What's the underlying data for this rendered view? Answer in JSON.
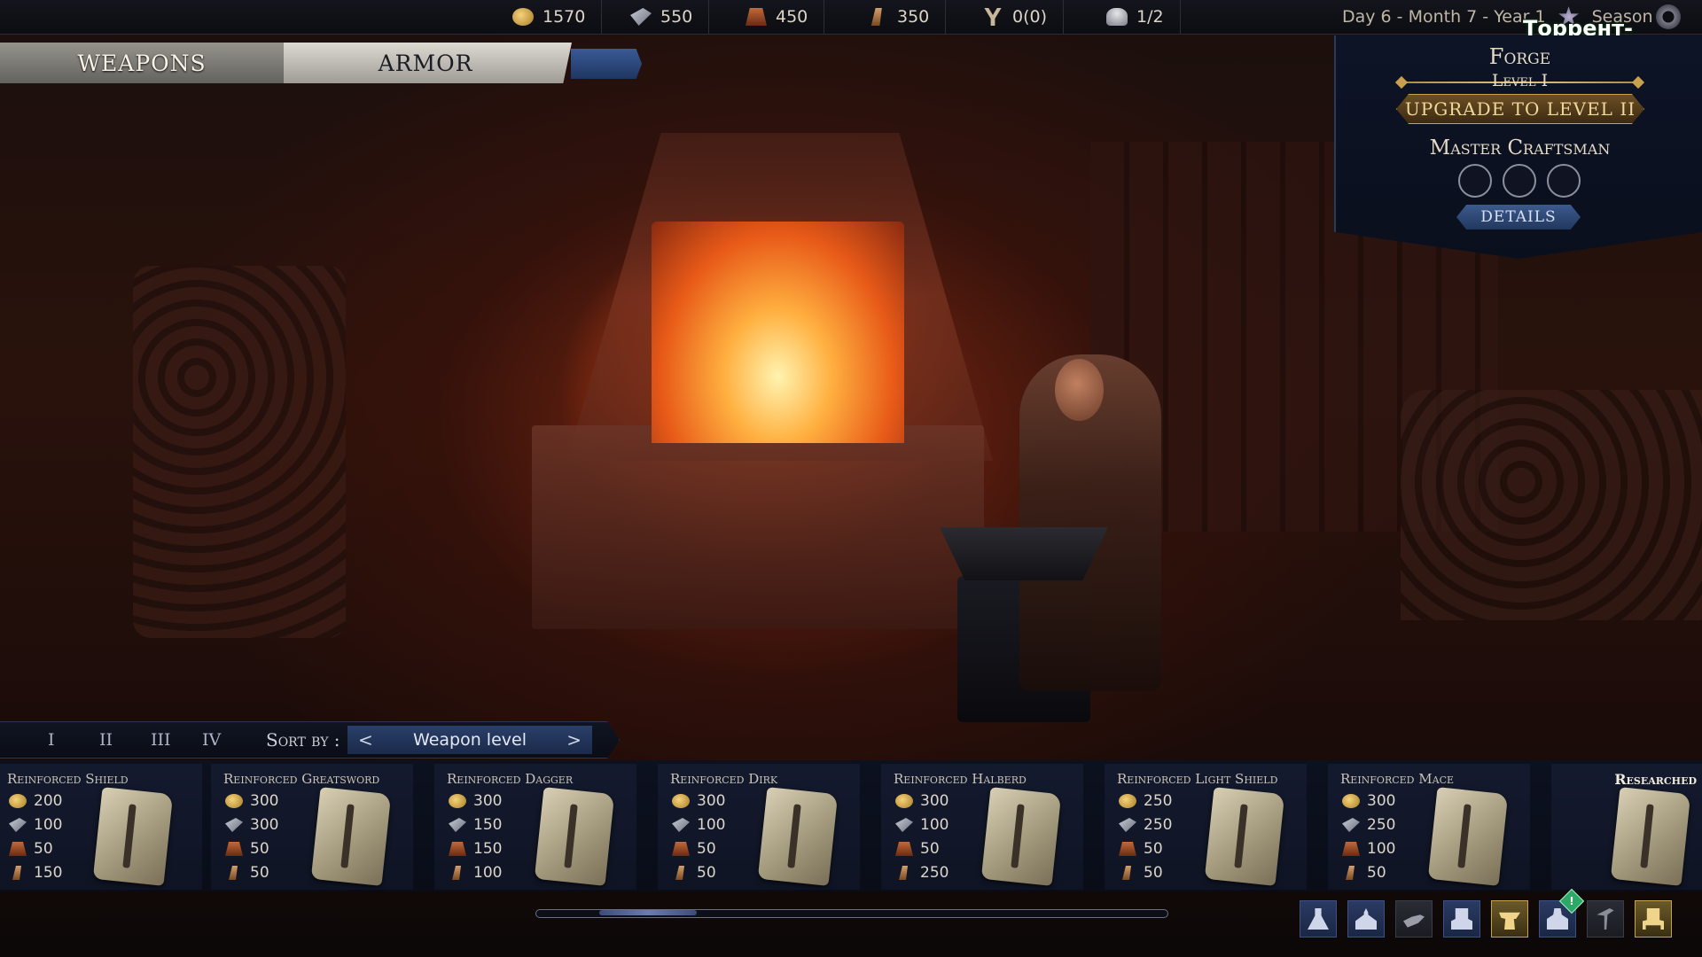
{
  "resources": [
    {
      "icon": "gold-coins-icon",
      "value": "1570"
    },
    {
      "icon": "iron-ingot-icon",
      "value": "550"
    },
    {
      "icon": "leather-icon",
      "value": "450"
    },
    {
      "icon": "wood-plank-icon",
      "value": "350"
    },
    {
      "icon": "tools-icon",
      "value": "0(0)"
    },
    {
      "icon": "population-icon",
      "value": "1/2"
    }
  ],
  "date": {
    "text": "Day 6 - Month 7 - Year 1",
    "season": "Season"
  },
  "watermark": "Торрент-Игруха.Орг",
  "tabs": [
    {
      "label": "WEAPONS",
      "active": true
    },
    {
      "label": "ARMOR",
      "active": false
    }
  ],
  "forge": {
    "title": "Forge",
    "level": "Level I",
    "upgrade_label": "UPGRADE TO LEVEL II",
    "master_title": "Master Craftsman",
    "slots": 3,
    "details_label": "DETAILS"
  },
  "tiers": [
    "I",
    "II",
    "III",
    "IV"
  ],
  "sort": {
    "label": "Sort by :",
    "value": "Weapon level",
    "prev": "<",
    "next": ">"
  },
  "recipes": [
    {
      "name": "Reinforced Shield",
      "costs": [
        "200",
        "100",
        "50",
        "150"
      ]
    },
    {
      "name": "Reinforced Greatsword",
      "costs": [
        "300",
        "300",
        "50",
        "50"
      ]
    },
    {
      "name": "Reinforced Dagger",
      "costs": [
        "300",
        "150",
        "150",
        "100"
      ]
    },
    {
      "name": "Reinforced Dirk",
      "costs": [
        "300",
        "100",
        "50",
        "50"
      ]
    },
    {
      "name": "Reinforced Halberd",
      "costs": [
        "300",
        "100",
        "50",
        "250"
      ]
    },
    {
      "name": "Reinforced Light Shield",
      "costs": [
        "250",
        "250",
        "50",
        "50"
      ]
    },
    {
      "name": "Reinforced Mace",
      "costs": [
        "300",
        "250",
        "100",
        "50"
      ]
    }
  ],
  "researched_label": "Researched",
  "bottom_icons": [
    "alchemy-flask-icon",
    "church-icon",
    "hand-icon",
    "throne-icon",
    "anvil-icon",
    "knight-icon",
    "scythe-icon",
    "chair-icon"
  ],
  "alert_badge": "!",
  "colors": {
    "accent_blue": "#2a3f6a",
    "gold": "#c9a24c",
    "forge_glow": "#ffb040"
  }
}
